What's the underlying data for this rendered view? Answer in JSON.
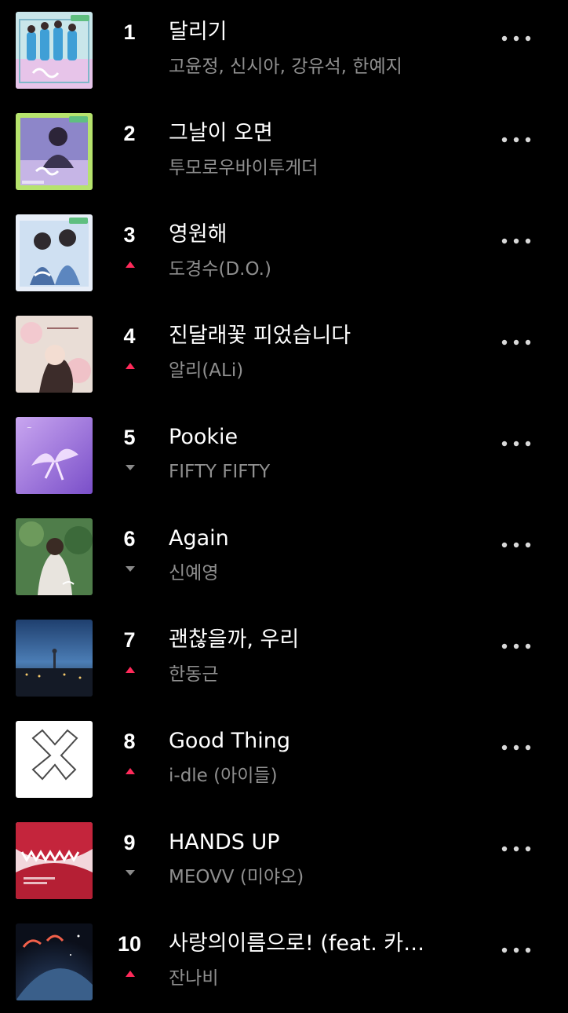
{
  "colors": {
    "background": "#000000",
    "title": "#ffffff",
    "artist": "#8f8f8f",
    "trend_up": "#ff2a5a",
    "trend_down": "#8a8a8a",
    "more_dots": "#d8d8d8"
  },
  "chart": {
    "items": [
      {
        "rank": "1",
        "title": "달리기",
        "artist": "고윤정, 신시아, 강유석, 한예지",
        "trend": "none",
        "cover_icon": "album-cover-icon"
      },
      {
        "rank": "2",
        "title": "그날이 오면",
        "artist": "투모로우바이투게더",
        "trend": "none",
        "cover_icon": "album-cover-icon"
      },
      {
        "rank": "3",
        "title": "영원해",
        "artist": "도경수(D.O.)",
        "trend": "up",
        "cover_icon": "album-cover-icon"
      },
      {
        "rank": "4",
        "title": "진달래꽃 피었습니다",
        "artist": "알리(ALi)",
        "trend": "up",
        "cover_icon": "album-cover-icon"
      },
      {
        "rank": "5",
        "title": "Pookie",
        "artist": "FIFTY FIFTY",
        "trend": "down",
        "cover_icon": "album-cover-icon"
      },
      {
        "rank": "6",
        "title": "Again",
        "artist": "신예영",
        "trend": "down",
        "cover_icon": "album-cover-icon"
      },
      {
        "rank": "7",
        "title": "괜찮을까, 우리",
        "artist": "한동근",
        "trend": "up",
        "cover_icon": "album-cover-icon"
      },
      {
        "rank": "8",
        "title": "Good Thing",
        "artist": "i-dle (아이들)",
        "trend": "up",
        "cover_icon": "album-cover-icon"
      },
      {
        "rank": "9",
        "title": "HANDS UP",
        "artist": "MEOVV (미야오)",
        "trend": "down",
        "cover_icon": "album-cover-icon"
      },
      {
        "rank": "10",
        "title": "사랑의이름으로! (feat. 카…",
        "artist": "잔나비",
        "trend": "up",
        "cover_icon": "album-cover-icon"
      }
    ]
  }
}
